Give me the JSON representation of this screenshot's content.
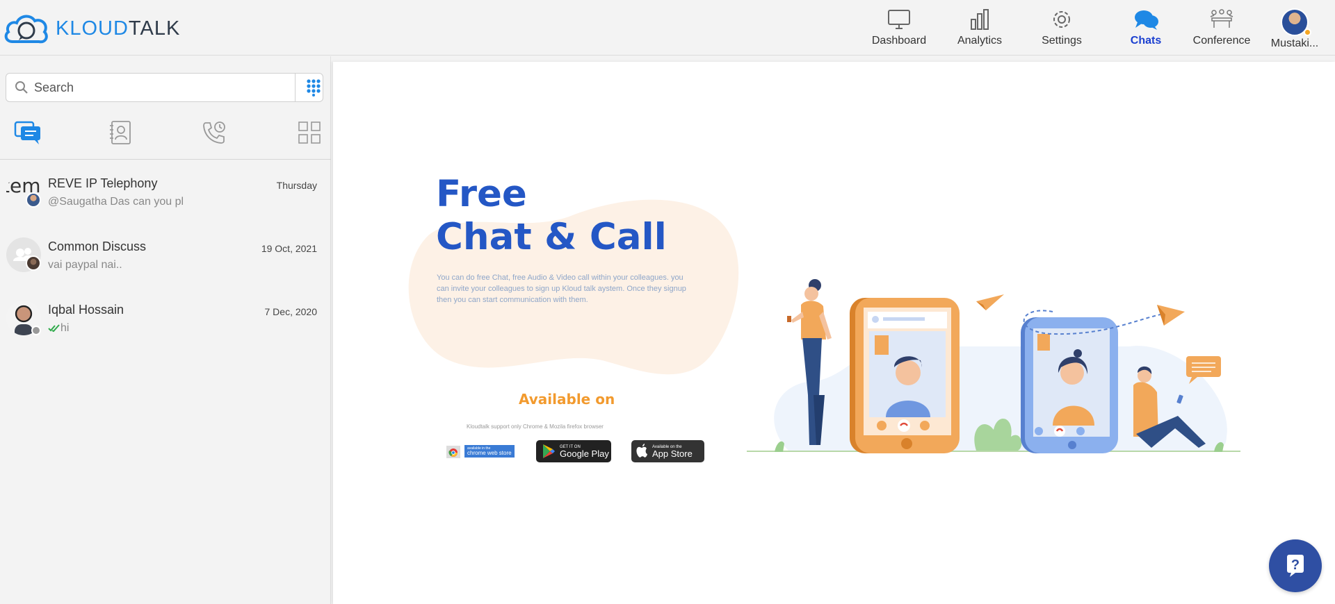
{
  "app": {
    "logo_text_1": "KLOUD",
    "logo_text_2": "TALK"
  },
  "nav": {
    "dashboard": "Dashboard",
    "analytics": "Analytics",
    "settings": "Settings",
    "chats": "Chats",
    "conference": "Conference",
    "profile_name": "Mustaki..."
  },
  "sidebar": {
    "search_placeholder": "Search",
    "chats": [
      {
        "name": "REVE IP Telephony",
        "date": "Thursday",
        "preview": "@Saugatha Das can you pl",
        "avatar_text": "tem"
      },
      {
        "name": "Common Discuss",
        "date": "19 Oct, 2021",
        "preview": "vai paypal nai.."
      },
      {
        "name": "Iqbal Hossain",
        "date": "7 Dec, 2020",
        "preview": "hi"
      }
    ]
  },
  "main": {
    "title_line1": "Free",
    "title_line2": "Chat & Call",
    "description": "You can do free Chat, free Audio & Video call within your colleagues. you can invite your colleagues to sign up Kloud talk aystem. Once they signup then you can start communication with them.",
    "available_on": "Available on",
    "support_note": "Kloudtalk support only Chrome & Mozila firefox browser",
    "badges": {
      "chrome_small": "available in the",
      "chrome_large": "chrome web store",
      "google_small": "GET IT ON",
      "google_large": "Google Play",
      "apple_small": "Available on the",
      "apple_large": "App Store"
    }
  },
  "colors": {
    "accent": "#1e88e5",
    "active_nav": "#1a3fd0",
    "title_blue": "#2457c5",
    "orange": "#f29a2e",
    "help_button": "#2f4fa3"
  }
}
